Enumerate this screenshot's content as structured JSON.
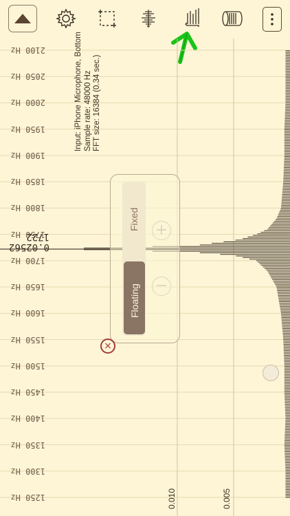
{
  "toolbar": {
    "buttons": [
      {
        "name": "play-toggle-button",
        "icon": "triangle-up-icon"
      },
      {
        "name": "settings-button",
        "icon": "gear-icon"
      },
      {
        "name": "select-region-button",
        "icon": "dashed-square-icon"
      },
      {
        "name": "spectrum-view-button",
        "icon": "waveform-icon"
      },
      {
        "name": "peak-hold-button",
        "icon": "bar-peaks-icon"
      },
      {
        "name": "export-button",
        "icon": "cylinder-icon"
      },
      {
        "name": "more-button",
        "icon": "more-vertical-icon"
      }
    ]
  },
  "info": {
    "input": "Input: iPhone Microphone, Bottom",
    "sample_rate": "Sample rate: 48000 Hz",
    "fft_size": "FFT size: 16384 (0.34 sec.)"
  },
  "frequency_labels": [
    "2100 Hz",
    "2050 Hz",
    "2000 Hz",
    "1950 Hz",
    "1900 Hz",
    "1850 Hz",
    "1800 Hz",
    "1750 Hz",
    "1700 Hz",
    "1650 Hz",
    "1600 Hz",
    "1550 Hz",
    "1500 Hz",
    "1450 Hz",
    "1400 Hz",
    "1350 Hz",
    "1300 Hz",
    "1250 Hz"
  ],
  "amplitude_ticks": [
    "0.010",
    "0.005"
  ],
  "cursor": {
    "frequency": "1722",
    "amplitude": "0.02562"
  },
  "scale_mode": {
    "options": [
      "Fixed",
      "Floating"
    ],
    "selected": "Floating"
  },
  "zoom": {
    "zoom_in": "+",
    "zoom_out": "−"
  },
  "close_label": "×",
  "annotation": {
    "type": "green-arrow",
    "target": "peak-hold-button"
  },
  "colors": {
    "background": "#fdf5d6",
    "grid": "#e6d9b0",
    "spectrum": "#3a2e24",
    "accent": "#8a7565",
    "arrow": "#19c419",
    "close": "#a33a3a"
  },
  "chart_data": {
    "type": "bar",
    "orientation": "horizontal-spectrum",
    "xlabel": "",
    "ylabel": "",
    "ylim_hz": [
      1250,
      2100
    ],
    "peak": {
      "frequency_hz": 1722,
      "amplitude": 0.02562
    },
    "x_ticks": [
      "0.010",
      "0.005"
    ],
    "frequency_hz": [
      1250,
      1300,
      1350,
      1400,
      1450,
      1500,
      1550,
      1600,
      1650,
      1680,
      1700,
      1710,
      1715,
      1720,
      1722,
      1725,
      1730,
      1740,
      1750,
      1760,
      1780,
      1800,
      1850,
      1900,
      1950,
      2000,
      2050,
      2100
    ],
    "amplitude": [
      0.0004,
      0.0004,
      0.0005,
      0.0004,
      0.0005,
      0.0005,
      0.0006,
      0.0008,
      0.0012,
      0.002,
      0.003,
      0.005,
      0.008,
      0.015,
      0.0256,
      0.015,
      0.008,
      0.0045,
      0.003,
      0.002,
      0.0012,
      0.0008,
      0.0006,
      0.0005,
      0.0005,
      0.0004,
      0.0004,
      0.0004
    ]
  }
}
